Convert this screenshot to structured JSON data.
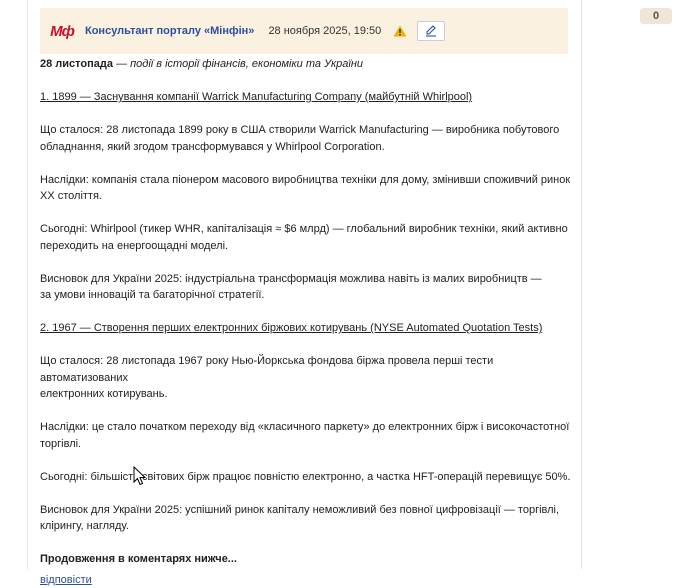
{
  "header": {
    "logo": "Мф",
    "author": "Консультант порталу «Мінфін»",
    "date": "28 ноября 2025, 19:50",
    "counter": "0"
  },
  "post": {
    "intro_bold": "28 листопада",
    "intro_italic": " — події в історії фінансів, економіки та України",
    "s1_title": "1. 1899 — Заснування компанії Warrick Manufacturing Company (майбутній Whirlpool)",
    "s1_what_1": "Що сталося: 28 листопада 1899 року в США створили Warrick Manufacturing — виробника побутового",
    "s1_what_2": "обладнання, який згодом трансформувався у Whirlpool Corporation.",
    "s1_cons_1": "Наслідки: компанія стала піонером масового виробництва техніки для дому, змінивши споживчий ринок",
    "s1_cons_2": "XX століття.",
    "s1_today_1": "Сьогодні: Whirlpool (тикер WHR, капіталізація ≈ $6 млрд) — глобальний виробник техніки, який активно",
    "s1_today_2": "переходить на енергоощадні моделі.",
    "s1_concl_1": "Висновок для України 2025: індустріальна трансформація можлива навіть із малих виробництв —",
    "s1_concl_2": "за умови інновацій та багаторічної стратегії.",
    "s2_title": "2. 1967 — Створення перших електронних біржових котирувань (NYSE Automated Quotation Tests)",
    "s2_what_1": "Що сталося: 28 листопада 1967 року Нью-Йоркська фондова біржа провела перші тести автоматизованих",
    "s2_what_2": "електронних котирувань.",
    "s2_cons_1": "Наслідки: це стало початком переходу від «класичного паркету» до електронних бірж і високочастотної",
    "s2_cons_2": "торгівлі.",
    "s2_today": "Сьогодні: більшість світових бірж працює повністю електронно, а частка HFT-операцій перевищує 50%.",
    "s2_concl_1": "Висновок для України 2025: успішний ринок капіталу неможливий без повної цифровізації — торгівлі,",
    "s2_concl_2": "клірингу, нагляду.",
    "continue": "Продовження в коментарях нижче...",
    "reply": "відповісти"
  },
  "colors": {
    "accent": "#2c4f9e",
    "header_bg": "#fbf1e1",
    "logo_red": "#c8102e"
  }
}
